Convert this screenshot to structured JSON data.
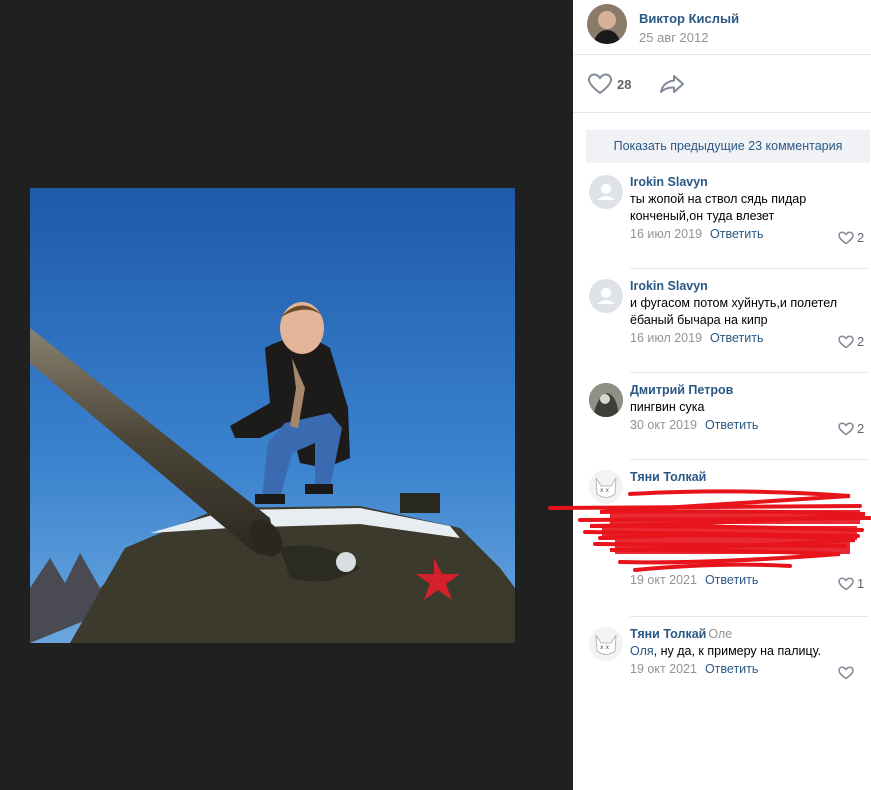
{
  "post": {
    "author": "Виктор Кислый",
    "date": "25 авг 2012",
    "likes": "28"
  },
  "more_comments_label": "Показать предыдущие 23 комментария",
  "reply_label": "Ответить",
  "comments": [
    {
      "author": "Irokin Slavyn",
      "text": "ты жопой на ствол сядь пидар конченый,он туда влезет",
      "date": "16 июл 2019",
      "likes": "2"
    },
    {
      "author": "Irokin Slavyn",
      "text": "и фугасом потом хуйнуть,и полетел ёбаный бычара на кипр",
      "date": "16 июл 2019",
      "likes": "2"
    },
    {
      "author": "Дмитрий Петров",
      "text": "пингвин сука",
      "date": "30 окт 2019",
      "likes": "2"
    },
    {
      "author": "Тяни Толкай",
      "text": "",
      "date": "19 окт 2021",
      "likes": "1"
    },
    {
      "author": "Тяни Толкай",
      "reply_to": "Оле",
      "mention": "Оля",
      "text": ", ну да, к примеру на палицу.",
      "date": "19 окт 2021",
      "likes": ""
    }
  ],
  "colors": {
    "link": "#2a5885",
    "muted": "#939393",
    "viewer_bg": "#202020",
    "scribble": "#e8141c"
  }
}
